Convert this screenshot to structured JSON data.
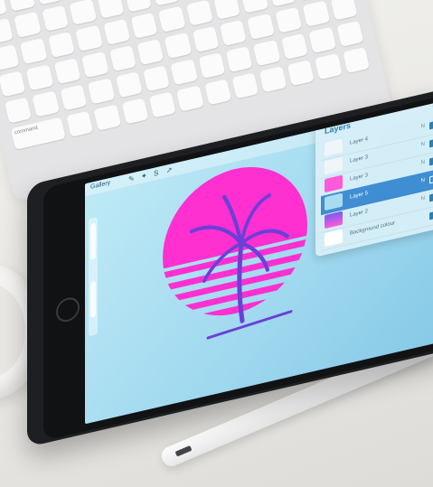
{
  "app": {
    "gallery_label": "Gallery"
  },
  "layers_panel": {
    "title": "Layers",
    "add_icon": "plus-icon",
    "rows": [
      {
        "name": "Layer 4",
        "mode": "N"
      },
      {
        "name": "Layer 3",
        "mode": "N"
      },
      {
        "name": "Layer 3",
        "mode": "N"
      },
      {
        "name": "Layer 5",
        "mode": "N"
      },
      {
        "name": "Layer 2",
        "mode": "N"
      },
      {
        "name": "Background colour",
        "mode": ""
      }
    ]
  },
  "artwork": {
    "sun_color": "#ff2fd0",
    "palm_color": "#6b3fd8"
  },
  "keyboard": {
    "label": "command"
  },
  "colors": {
    "accent": "#2f7fb2",
    "selected_layer": "#3f8ed3"
  }
}
